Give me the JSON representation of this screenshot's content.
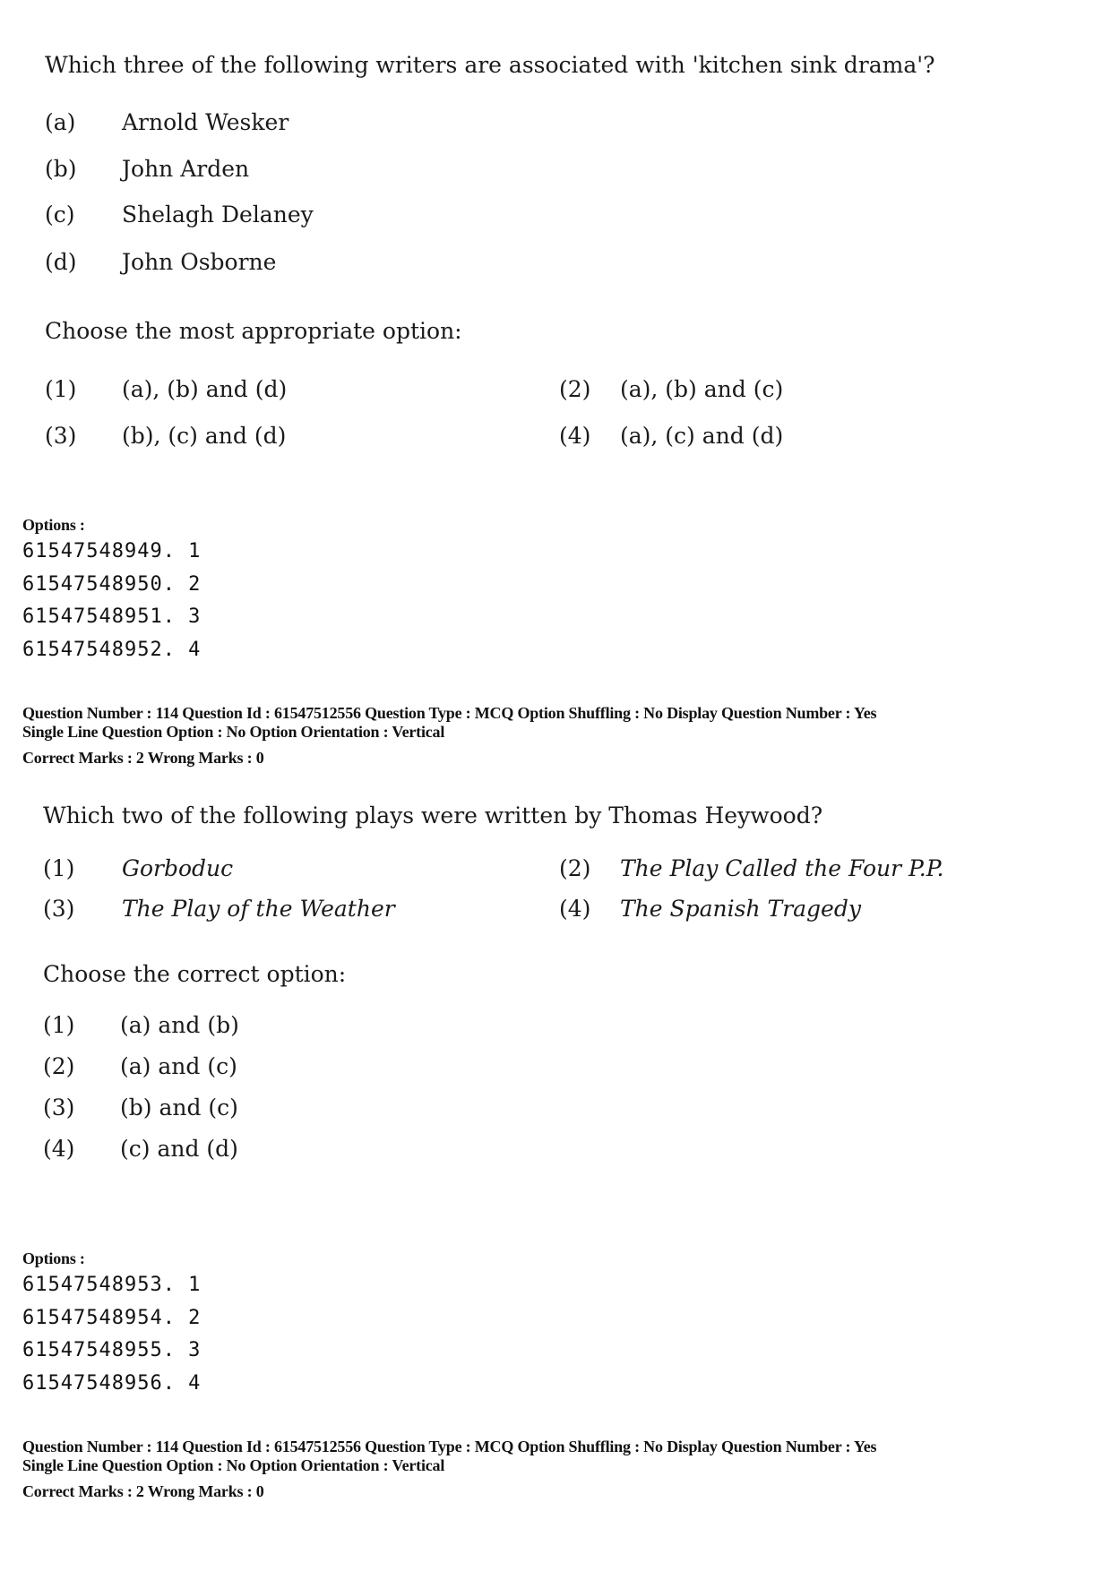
{
  "question1": {
    "stem": "Which three of the following writers are associated with 'kitchen sink drama'?",
    "items": [
      {
        "label": "(a)",
        "text": "Arnold Wesker"
      },
      {
        "label": "(b)",
        "text": "John Arden"
      },
      {
        "label": "(c)",
        "text": "Shelagh Delaney"
      },
      {
        "label": "(d)",
        "text": "John Osborne"
      }
    ],
    "instruction": "Choose the most appropriate option:",
    "choices": [
      {
        "label": "(1)",
        "text": "(a), (b) and (d)"
      },
      {
        "label": "(2)",
        "text": "(a), (b) and (c)"
      },
      {
        "label": "(3)",
        "text": "(b), (c) and (d)"
      },
      {
        "label": "(4)",
        "text": "(a), (c) and (d)"
      }
    ],
    "options_heading": "Options :",
    "option_ids": [
      "61547548949. 1",
      "61547548950. 2",
      "61547548951. 3",
      "61547548952. 4"
    ]
  },
  "meta1": {
    "line1": "Question Number : 114  Question Id : 61547512556  Question Type : MCQ  Option Shuffling : No  Display Question Number : Yes",
    "line2": "Single Line Question Option : No  Option Orientation : Vertical",
    "line3": "Correct Marks : 2  Wrong Marks : 0"
  },
  "question2": {
    "stem": "Which two of the following plays were written by Thomas Heywood?",
    "items": [
      {
        "label": "(1)",
        "text": "Gorboduc"
      },
      {
        "label": "(2)",
        "text": "The Play Called the Four P.P."
      },
      {
        "label": "(3)",
        "text": "The Play of the Weather"
      },
      {
        "label": "(4)",
        "text": "The Spanish Tragedy"
      }
    ],
    "instruction": "Choose the correct option:",
    "choices": [
      {
        "label": "(1)",
        "text": "(a) and (b)"
      },
      {
        "label": "(2)",
        "text": "(a) and (c)"
      },
      {
        "label": "(3)",
        "text": "(b) and (c)"
      },
      {
        "label": "(4)",
        "text": "(c) and (d)"
      }
    ],
    "options_heading": "Options :",
    "option_ids": [
      "61547548953. 1",
      "61547548954. 2",
      "61547548955. 3",
      "61547548956. 4"
    ]
  },
  "meta2": {
    "line1": "Question Number : 114  Question Id : 61547512556  Question Type : MCQ  Option Shuffling : No  Display Question Number : Yes",
    "line2": "Single Line Question Option : No  Option Orientation : Vertical",
    "line3": "Correct Marks : 2  Wrong Marks : 0"
  }
}
